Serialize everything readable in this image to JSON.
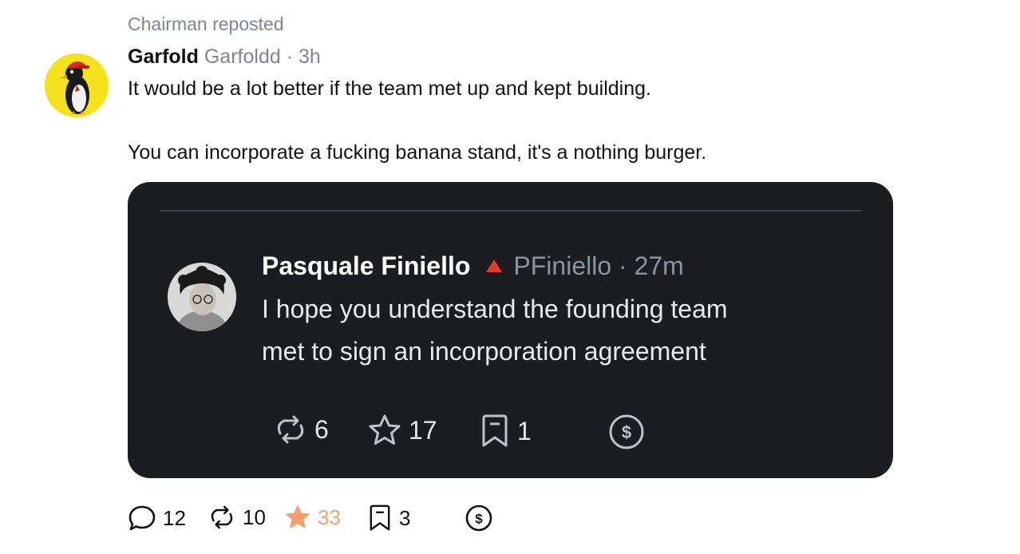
{
  "repost": {
    "label": "Chairman reposted"
  },
  "post": {
    "author_name": "Garfold",
    "author_handle": "Garfoldd",
    "separator": "·",
    "time": "3h",
    "text_line1": "It would be a lot better if the team met up and kept building.",
    "text_line2": "You can incorporate a fucking banana stand, it's a nothing burger."
  },
  "embed": {
    "author_name": "Pasquale Finiello",
    "author_handle": "PFiniello",
    "separator": "·",
    "time": "27m",
    "text_line1": "I hope you understand the founding team",
    "text_line2": "met to sign an incorporation agreement",
    "reposts": "6",
    "stars": "17",
    "bookmarks": "1"
  },
  "actions": {
    "replies": "12",
    "reposts": "10",
    "stars": "33",
    "bookmarks": "3"
  },
  "icons": {
    "reply": "speech-bubble-icon",
    "repost": "repost-arrows-icon",
    "star": "star-icon",
    "bookmark": "bookmark-icon",
    "tip": "dollar-coin-icon",
    "badge": "red-triangle-icon"
  },
  "colors": {
    "star_active": "#f2a070",
    "badge": "#e63a2e",
    "embed_bg": "#1c1d21",
    "avatar_bg": "#f5e11c"
  }
}
